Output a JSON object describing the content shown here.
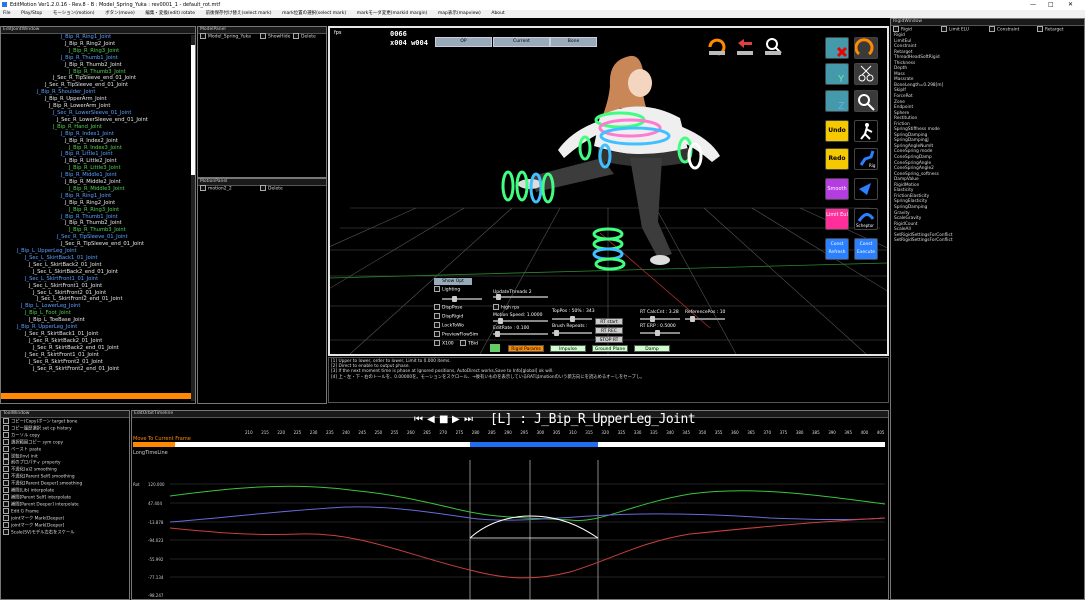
{
  "window": {
    "title": "EditMotion Ver1.2.0.16 - Rev.8 - B : Model_Spring_Yuka : rev0001_1 - default_rot.mtf",
    "controls": [
      "—",
      "□",
      "✕"
    ]
  },
  "menu": [
    "File",
    "Play/Stop",
    "モーション(motion)",
    "ボタン(move)",
    "編集・変換(edit) rotate",
    "前後保存付け替え(select mark)",
    "mark位置の選択(select mark)",
    "markモーダ変更(markid margin)",
    "map表示(mapview)",
    "About"
  ],
  "panels": {
    "left_title": "EditJointWindow",
    "model_title": "ModelPanel",
    "model_entry": "Model_Spring_Yuka",
    "model_show": "ShowHide",
    "model_delete": "Delete",
    "motion_title": "MotionPanel",
    "motion_entry": "motion2_2",
    "motion_delete": "Delete",
    "right_title": "RigidWindow",
    "right_tabs": [
      "Rigid",
      "Limit ELU",
      "Constraint",
      "Retarget"
    ],
    "tool_title": "ToolWindow",
    "timeline_title": "EditOrbitTimeline"
  },
  "tree": [
    {
      "t": "J_Bip_R_Ring1_Joint",
      "c": "blue",
      "d": 60
    },
    {
      "t": "J_Bip_R_Ring2_Joint",
      "c": "white",
      "d": 64
    },
    {
      "t": "J_Bip_R_Ring3_Joint",
      "c": "green",
      "d": 68
    },
    {
      "t": "J_Bip_R_Thumb1_Joint",
      "c": "blue",
      "d": 60
    },
    {
      "t": "J_Bip_R_Thumb2_Joint",
      "c": "white",
      "d": 64
    },
    {
      "t": "J_Bip_R_Thumb3_Joint",
      "c": "green",
      "d": 68
    },
    {
      "t": "J_Sec_R_TipSleeve_end_01_Joint",
      "c": "white",
      "d": 52
    },
    {
      "t": "J_Sec_R_TipSleeve_end_01_Joint",
      "c": "white",
      "d": 44
    },
    {
      "t": "J_Bip_R_Shoulder_Joint",
      "c": "blue",
      "d": 36
    },
    {
      "t": "J_Bip_R_UpperArm_Joint",
      "c": "white",
      "d": 44
    },
    {
      "t": "J_Bip_R_LowerArm_Joint",
      "c": "white",
      "d": 48
    },
    {
      "t": "J_Sec_R_LowerSleeve_01_Joint",
      "c": "blue",
      "d": 52
    },
    {
      "t": "J_Sec_R_LowerSleeve_end_01_Joint",
      "c": "white",
      "d": 56
    },
    {
      "t": "J_Bip_R_Hand_Joint",
      "c": "green",
      "d": 52
    },
    {
      "t": "J_Bip_R_Index1_Joint",
      "c": "blue",
      "d": 60
    },
    {
      "t": "J_Bip_R_Index2_Joint",
      "c": "white",
      "d": 64
    },
    {
      "t": "J_Bip_R_Index3_Joint",
      "c": "green",
      "d": 68
    },
    {
      "t": "J_Bip_R_Little1_Joint",
      "c": "blue",
      "d": 60
    },
    {
      "t": "J_Bip_R_Little2_Joint",
      "c": "white",
      "d": 64
    },
    {
      "t": "J_Bip_R_Little3_Joint",
      "c": "green",
      "d": 68
    },
    {
      "t": "J_Bip_R_Middle1_Joint",
      "c": "blue",
      "d": 60
    },
    {
      "t": "J_Bip_R_Middle2_Joint",
      "c": "white",
      "d": 64
    },
    {
      "t": "J_Bip_R_Middle3_Joint",
      "c": "green",
      "d": 68
    },
    {
      "t": "J_Bip_R_Ring1_Joint",
      "c": "blue",
      "d": 60
    },
    {
      "t": "J_Bip_R_Ring2_Joint",
      "c": "white",
      "d": 64
    },
    {
      "t": "J_Bip_R_Ring3_Joint",
      "c": "green",
      "d": 68
    },
    {
      "t": "J_Bip_R_Thumb1_Joint",
      "c": "blue",
      "d": 60
    },
    {
      "t": "J_Bip_R_Thumb2_Joint",
      "c": "white",
      "d": 64
    },
    {
      "t": "J_Bip_R_Thumb3_Joint",
      "c": "green",
      "d": 68
    },
    {
      "t": "J_Sec_R_TipSleeve_01_Joint",
      "c": "blue",
      "d": 56
    },
    {
      "t": "J_Sec_R_TipSleeve_end_01_Joint",
      "c": "white",
      "d": 60
    },
    {
      "t": "J_Bip_L_UpperLeg_Joint",
      "c": "blue",
      "d": 16
    },
    {
      "t": "J_Sec_L_SkirtBack1_01_Joint",
      "c": "blue",
      "d": 24
    },
    {
      "t": "J_Sec_L_SkirtBack2_01_Joint",
      "c": "white",
      "d": 28
    },
    {
      "t": "J_Sec_L_SkirtBack2_end_01_Joint",
      "c": "white",
      "d": 32
    },
    {
      "t": "J_Sec_L_SkirtFront1_01_Joint",
      "c": "blue",
      "d": 24
    },
    {
      "t": "J_Sec_L_SkirtFront1_01_Joint",
      "c": "white",
      "d": 28
    },
    {
      "t": "J_Sec_L_SkirtFront2_01_Joint",
      "c": "white",
      "d": 32
    },
    {
      "t": "J_Sec_L_SkirtFront2_end_01_Joint",
      "c": "white",
      "d": 36
    },
    {
      "t": "J_Bip_L_LowerLeg_Joint",
      "c": "blue",
      "d": 20
    },
    {
      "t": "J_Bip_L_Foot_Joint",
      "c": "green",
      "d": 24
    },
    {
      "t": "J_Bip_L_ToeBase_Joint",
      "c": "white",
      "d": 28
    },
    {
      "t": "J_Bip_R_UpperLeg_Joint",
      "c": "blue",
      "d": 16
    },
    {
      "t": "J_Sec_R_SkirtBack1_01_Joint",
      "c": "white",
      "d": 24
    },
    {
      "t": "J_Sec_R_SkirtBack2_01_Joint",
      "c": "white",
      "d": 28
    },
    {
      "t": "J_Sec_R_SkirtBack2_end_01_Joint",
      "c": "white",
      "d": 32
    },
    {
      "t": "J_Sec_R_SkirtFront1_01_Joint",
      "c": "white",
      "d": 24
    },
    {
      "t": "J_Sec_R_SkirtFront2_01_Joint",
      "c": "white",
      "d": 28
    },
    {
      "t": "J_Sec_R_SkirtFront2_end_01_Joint",
      "c": "white",
      "d": 32
    }
  ],
  "viewport": {
    "fps_label": "fps",
    "fps": "0066",
    "frame": "x004 w004",
    "dropdown1": "OP",
    "dropdown2": "Current",
    "dropdown3": "Bone",
    "side_buttons": [
      "Undo",
      "Redo",
      "Smooth",
      "Limit Eul",
      "Const Refresh",
      "Const Execute"
    ],
    "side_icons": [
      "Rig",
      "Scheptor"
    ],
    "settings": {
      "header": "Show Opt",
      "checks": [
        "Lighting",
        "DispPose",
        "DispRigid",
        "LockToWo",
        "PreviewFlowSim",
        "X100",
        "TBid"
      ],
      "update_threads": "UpdateThreads 2",
      "high_rps": "high rps",
      "motion_speed": "Motion Speed: 1.0000",
      "edit_rate": "EditRate : 0.100",
      "toe_pos": "TopPos : 50% : 343",
      "brush_repeats": "Brush Repeats :",
      "calc_cnt": "RT CalcCnt : 3.28",
      "ref_pos": "ReferencePos : 10",
      "rt_erp": "RT ERP : 0.5000",
      "small_btns": [
        "RT start",
        "RT REC",
        "STOP RT"
      ],
      "bottom_buttons": [
        "Rigid Params",
        "Impulse",
        "Ground Plane",
        "Damp"
      ]
    }
  },
  "log": [
    "[1] Upper to lower, order to lower, Limit to 0.000 items.",
    "[2] Direct to enable to output phase.",
    "[3] If the next moment time is phase at Ignored positions, AutoDirect works,Save to Info[global] ok will.",
    "[4] 上・左・下・右のトールを、0.00000を。モーションをスクロール、→後有いものを表示しているRATはmotionのいう新方向にを読込めるオーしをセーブし。"
  ],
  "right_rows": [
    "Rigid",
    "LimitEul",
    "Constraint",
    "Retarget",
    "ThreadHeadSoftRigid",
    "Thickness",
    "",
    "Depth",
    "  ",
    "Mass",
    "  ",
    "Massrate",
    "",
    "BoneLength=0.298[m]",
    "SkipIf",
    "ForceRot",
    "Zone",
    "Endpoint",
    "Sphere",
    "Restitution",
    "Friction",
    "SpringStiffness mode",
    "SpringDamping",
    "SpringDampingJ",
    "SpringAngleNumIt",
    "",
    "ConeSpring mode",
    "ConeSpringDamp",
    "ConeSpringAngle",
    "ConeSpringAngle2",
    "ConeSpring_softness",
    "",
    "DampValue",
    "RigidMotion",
    "",
    "Elasticity",
    "",
    "FrictionElasticity",
    "",
    "SpringElasticity",
    "",
    "SpringDamping",
    "",
    "Gravity",
    "ScaleGravity",
    "",
    "RigidCount",
    "ScaleAll",
    "SetRigidSettingsForConflict",
    "SetRigidSettingsForConflict"
  ],
  "tool_rows": [
    "コピー(Copy)ボーン target bone",
    "コピー履歴選択 set cp history",
    "カーソル copy",
    "選択範囲コピー sym copy",
    "ペースト paste",
    "逆転(Inv) init",
    "前のプロパティ property",
    "不透化(a)2 smoothing",
    "不透化[Parent Self] smoothing",
    "不透化[Parent Deeper] smoothing",
    "補間(Lib) interpolate",
    "補間[Parent Self] interpolate",
    "補間[Parent Deeper] interpolate",
    "Edit G Frame",
    "jointマーク Mark(Deeper)",
    "jointマーク Mark[Deeper]",
    "Scale(SV)モデル左右をスケール"
  ],
  "timeline": {
    "joint_label": "[L] : J_Bip_R_UpperLeg_Joint",
    "move_label": "Move To Current Frame",
    "longtime_label": "LongTimeLine",
    "axis_name": "Rot",
    "yticks": [
      "120.000",
      "47.404",
      "-13.878",
      "-94.023",
      "-55.992",
      "-77.134",
      "-98.247"
    ],
    "frames": [
      "210",
      "215",
      "220",
      "225",
      "230",
      "235",
      "240",
      "245",
      "250",
      "255",
      "260",
      "265",
      "270",
      "275",
      "280",
      "285",
      "290",
      "295",
      "300",
      "305",
      "310",
      "315",
      "320",
      "325",
      "330",
      "335",
      "340",
      "345",
      "350",
      "355",
      "360",
      "365",
      "370",
      "375",
      "380",
      "385",
      "390",
      "395",
      "400",
      "405"
    ]
  },
  "colors": {
    "blue": "#5aa0ff",
    "green": "#4fd24f",
    "orange": "#ff8a00",
    "timeline_blue": "#1e6ef0",
    "undo_yellow": "#f5c800",
    "smooth_purple": "#b43ce0",
    "limit_pink": "#ff2e9a"
  }
}
